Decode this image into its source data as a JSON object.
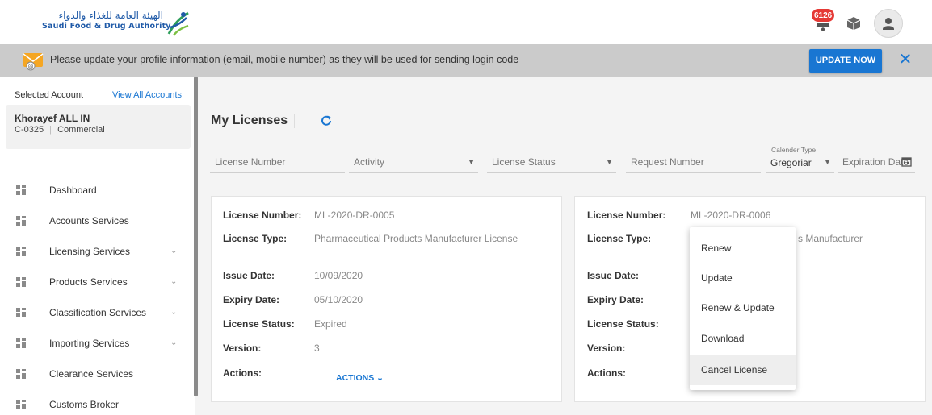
{
  "header": {
    "logo_arabic": "الهيئة العامة للغذاء والدواء",
    "logo_english": "Saudi Food & Drug Authority",
    "notification_count": "6126"
  },
  "banner": {
    "message": "Please update your profile information (email, mobile number) as they will be used for sending login code",
    "update_button": "UPDATE NOW",
    "close": "✕"
  },
  "sidebar": {
    "selected_account_label": "Selected Account",
    "view_all_label": "View All Accounts",
    "account_name": "Khorayef ALL IN",
    "account_id": "C-0325",
    "account_type": "Commercial",
    "items": [
      {
        "label": "Dashboard",
        "has_submenu": false
      },
      {
        "label": "Accounts Services",
        "has_submenu": false
      },
      {
        "label": "Licensing Services",
        "has_submenu": true
      },
      {
        "label": "Products Services",
        "has_submenu": true
      },
      {
        "label": "Classification Services",
        "has_submenu": true
      },
      {
        "label": "Importing Services",
        "has_submenu": true
      },
      {
        "label": "Clearance Services",
        "has_submenu": false
      },
      {
        "label": "Customs Broker",
        "has_submenu": false
      }
    ]
  },
  "main": {
    "title": "My Licenses",
    "filters": {
      "license_number": "License Number",
      "activity": "Activity",
      "license_status": "License Status",
      "request_number": "Request Number",
      "calendar_type_label": "Calender Type",
      "calendar_type_value": "Gregoriar",
      "expiration_date": "Expiration Date"
    },
    "field_labels": {
      "license_number": "License Number:",
      "license_type": "License Type:",
      "issue_date": "Issue Date:",
      "expiry_date": "Expiry Date:",
      "license_status": "License Status:",
      "version": "Version:",
      "actions": "Actions:"
    },
    "cards": [
      {
        "license_number": "ML-2020-DR-0005",
        "license_type": "Pharmaceutical Products Manufacturer License",
        "issue_date": "10/09/2020",
        "expiry_date": "05/10/2020",
        "license_status": "Expired",
        "version": "3",
        "actions_label": "ACTIONS ⌄"
      },
      {
        "license_number": "ML-2020-DR-0006",
        "license_type_visible": "s Manufacturer"
      }
    ],
    "actions_menu": [
      "Renew",
      "Update",
      "Renew & Update",
      "Download",
      "Cancel License"
    ],
    "hovered_menu_item": "Cancel License"
  },
  "colors": {
    "accent": "#1976d2",
    "banner_bg": "#cbcbcb",
    "badge": "#e53935"
  }
}
